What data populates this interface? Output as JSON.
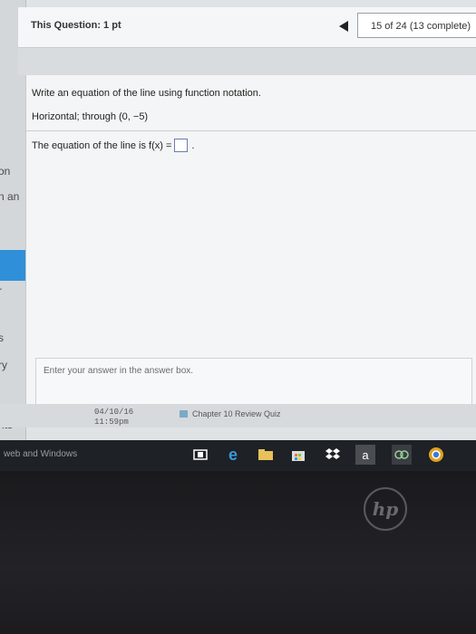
{
  "header": {
    "question_label": "This Question: 1 pt",
    "counter": "15 of 24 (13 complete)"
  },
  "question": {
    "instruction": "Write an equation of the line using function notation.",
    "condition": "Horizontal; through (0, −5)",
    "equation_prefix": "The equation of the line is f(x) =",
    "equation_suffix": ".",
    "answer_value": ""
  },
  "hint": "Enter your answer in the answer box.",
  "left_strip": {
    "items": [
      "on",
      "n an",
      "r",
      "s",
      "ry",
      "nts"
    ]
  },
  "calendar": {
    "date": "04/10/16",
    "time": "11:59pm",
    "event": "Chapter 10 Review Quiz"
  },
  "taskbar": {
    "search_text": "web and Windows",
    "icons": [
      "task-view-icon",
      "edge-icon",
      "file-explorer-icon",
      "store-icon",
      "dropbox-icon",
      "amazon-icon",
      "app-icon",
      "chrome-icon"
    ]
  },
  "bezel": {
    "logo": "hp"
  }
}
